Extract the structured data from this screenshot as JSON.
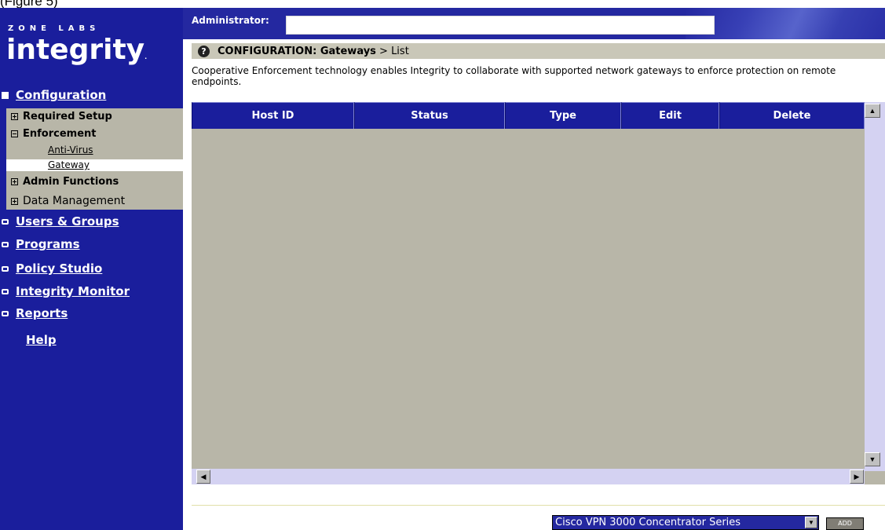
{
  "caption": "(Figure 5)",
  "brand": {
    "top": "ZONE LABS",
    "logo": "integrity",
    "tm": "."
  },
  "header": {
    "admin_label": "Administrator:",
    "admin_value": ""
  },
  "sidebar": {
    "configuration": "Configuration",
    "config_items": {
      "required_setup": "Required Setup",
      "enforcement": "Enforcement",
      "anti_virus": "Anti-Virus",
      "gateway": "Gateway",
      "admin_functions": "Admin Functions",
      "data_management": "Data Management"
    },
    "sections": {
      "users_groups": "Users & Groups",
      "programs": "Programs",
      "policy_studio": "Policy Studio",
      "integrity_monitor": "Integrity Monitor",
      "reports": "Reports"
    },
    "help": "Help"
  },
  "title": {
    "prefix": "CONFIGURATION: Gateways",
    "suffix": " > List",
    "help_icon": "?"
  },
  "description": "Cooperative Enforcement technology enables Integrity to collaborate with supported network gateways to enforce protection on remote endpoints.",
  "table": {
    "columns": [
      "Host ID",
      "Status",
      "Type",
      "Edit",
      "Delete"
    ],
    "rows": []
  },
  "footer": {
    "gateway_type": "Cisco VPN 3000 Concentrator Series",
    "add_label": "ADD"
  },
  "colors": {
    "sidebar": "#1a1e9c",
    "header": "#2428a0",
    "table_bg": "#b8b6a8",
    "title_strip": "#c9c7b8"
  }
}
